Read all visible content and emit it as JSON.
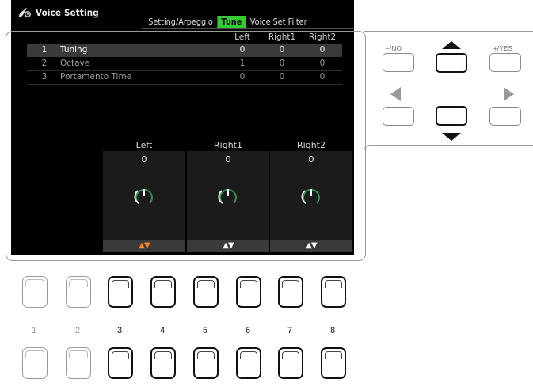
{
  "screen": {
    "title": "Voice Setting",
    "tabs": [
      {
        "label": "Setting/Arpeggio",
        "active": false
      },
      {
        "label": "Tune",
        "active": true
      },
      {
        "label": "Voice Set Filter",
        "active": false
      }
    ],
    "columns": [
      "Left",
      "Right1",
      "Right2"
    ],
    "params": [
      {
        "num": "1",
        "name": "Tuning",
        "left": "0",
        "right1": "0",
        "right2": "0",
        "selected": true
      },
      {
        "num": "2",
        "name": "Octave",
        "left": "1",
        "right1": "0",
        "right2": "0",
        "selected": false
      },
      {
        "num": "3",
        "name": "Portamento Time",
        "left": "0",
        "right1": "0",
        "right2": "0",
        "selected": false
      }
    ],
    "knobs": [
      {
        "label": "Left",
        "value": "0",
        "arrows": "▲▼",
        "active": true
      },
      {
        "label": "Right1",
        "value": "0",
        "arrows": "▲▼",
        "active": false
      },
      {
        "label": "Right2",
        "value": "0",
        "arrows": "▲▼",
        "active": false
      }
    ],
    "colors": {
      "tab_active": "#33cc33",
      "arrows_active": "#ff8a1e"
    }
  },
  "panel": {
    "no_label": "−/NO",
    "yes_label": "+/YES",
    "soft_buttons": [
      "1",
      "2",
      "3",
      "4",
      "5",
      "6",
      "7",
      "8"
    ]
  }
}
